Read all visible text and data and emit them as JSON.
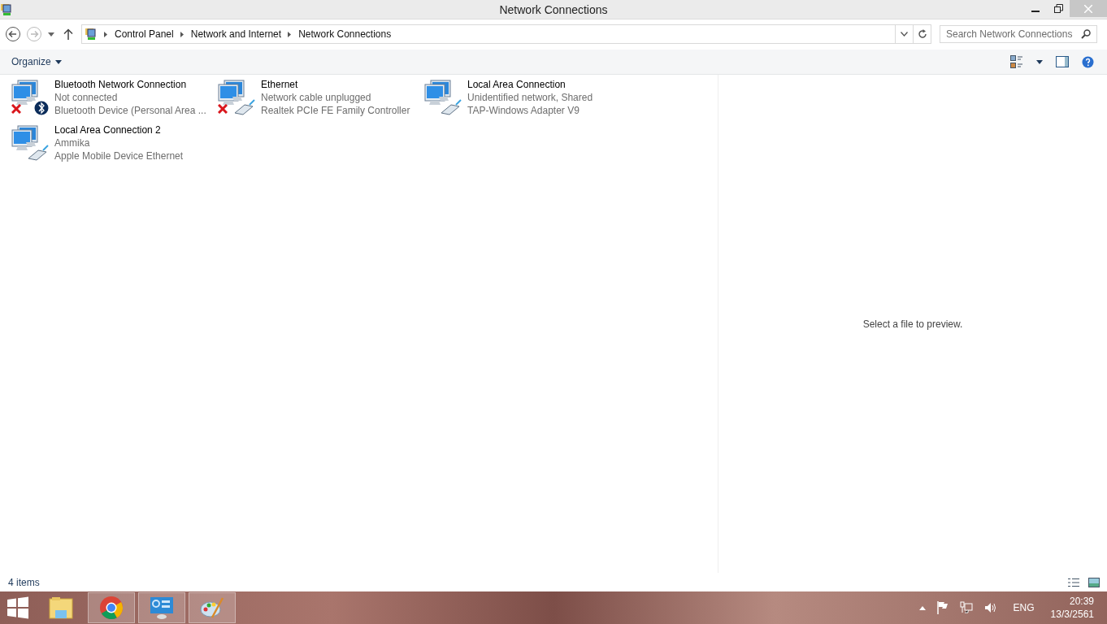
{
  "window": {
    "title": "Network Connections"
  },
  "breadcrumb": [
    "Control Panel",
    "Network and Internet",
    "Network Connections"
  ],
  "search": {
    "placeholder": "Search Network Connections"
  },
  "toolbar": {
    "organize": "Organize"
  },
  "connections": [
    {
      "name": "Bluetooth Network Connection",
      "status": "Not connected",
      "device": "Bluetooth Device (Personal Area ...",
      "kind": "bluetooth",
      "disconnected": true
    },
    {
      "name": "Ethernet",
      "status": "Network cable unplugged",
      "device": "Realtek PCIe FE Family Controller",
      "kind": "ethernet",
      "disconnected": true
    },
    {
      "name": "Local Area Connection",
      "status": "Unidentified network, Shared",
      "device": "TAP-Windows Adapter V9",
      "kind": "ethernet",
      "disconnected": false
    },
    {
      "name": "Local Area Connection 2",
      "status": "Ammika",
      "device": "Apple Mobile Device Ethernet",
      "kind": "ethernet",
      "disconnected": false
    }
  ],
  "preview": {
    "message": "Select a file to preview."
  },
  "status_bar": {
    "count": "4 items"
  },
  "taskbar": {
    "apps": [
      {
        "kind": "explorer",
        "open": false
      },
      {
        "kind": "chrome",
        "open": true
      },
      {
        "kind": "control",
        "open": true
      },
      {
        "kind": "paint",
        "open": true
      }
    ],
    "language": "ENG",
    "time": "20:39",
    "date": "13/3/2561"
  }
}
